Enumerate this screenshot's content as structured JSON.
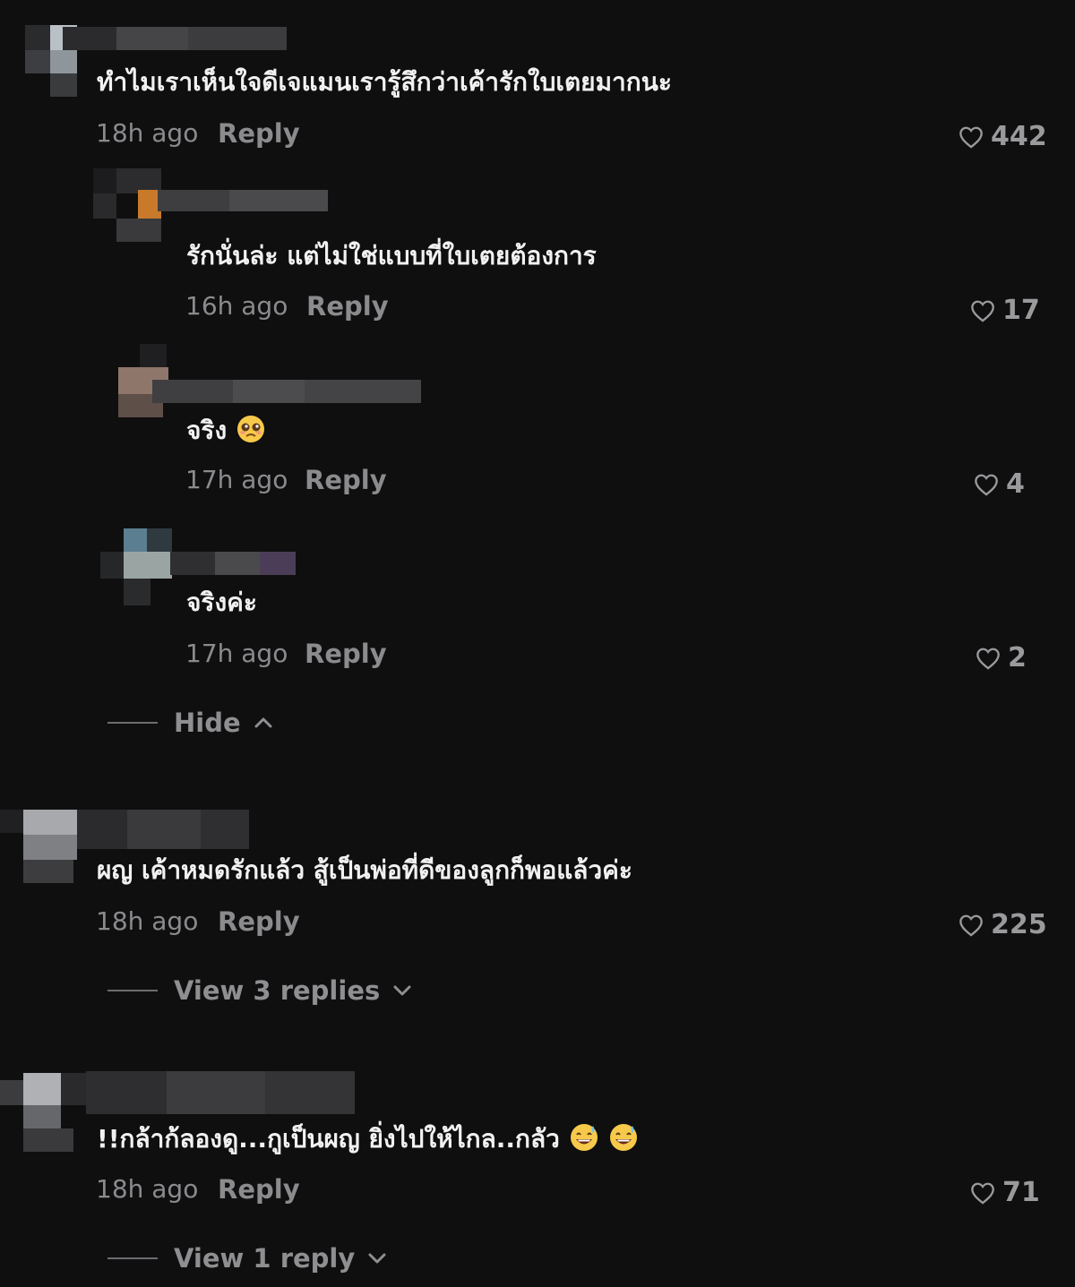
{
  "colors": {
    "background": "#0f0f10",
    "text_primary": "#f1f1f1",
    "text_secondary": "#8b8b8e"
  },
  "comments": [
    {
      "text": "ทำไมเราเห็นใจดีเจแมนเรารู้สึกว่าเค้ารักใบเตยมากนะ",
      "time": "18h ago",
      "reply_label": "Reply",
      "likes": "442",
      "replies": [
        {
          "text": "รักนั่นล่ะ แต่ไม่ใช่แบบที่ใบเตยต้องการ",
          "time": "16h ago",
          "reply_label": "Reply",
          "likes": "17"
        },
        {
          "text": "จริง",
          "emoji": "pleading-face-emoji",
          "time": "17h ago",
          "reply_label": "Reply",
          "likes": "4"
        },
        {
          "text": "จริงค่ะ",
          "time": "17h ago",
          "reply_label": "Reply",
          "likes": "2"
        }
      ],
      "toggle_label": "Hide",
      "toggle_icon": "chevron-up-icon"
    },
    {
      "text": "ผญ เค้าหมดรักแล้ว สู้เป็นพ่อที่ดีของลูกก็พอแล้วค่ะ",
      "time": "18h ago",
      "reply_label": "Reply",
      "likes": "225",
      "toggle_label": "View 3 replies",
      "toggle_icon": "chevron-down-icon"
    },
    {
      "text": "!!กล้าก้ลองดู...กูเป็นผญ ยิ่งไปให้ไกล..กลัว",
      "emoji": "grinning-sweat-emoji",
      "time": "18h ago",
      "reply_label": "Reply",
      "likes": "71",
      "toggle_label": "View 1 reply",
      "toggle_icon": "chevron-down-icon"
    }
  ]
}
